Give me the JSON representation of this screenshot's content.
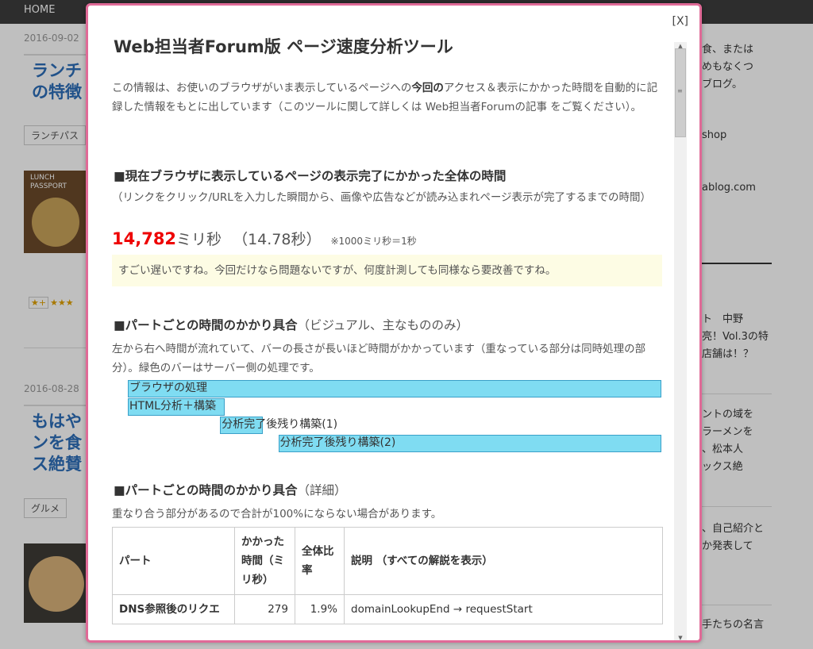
{
  "background": {
    "nav": {
      "home": "HOME"
    },
    "posts": [
      {
        "date": "2016-09-02",
        "title": "ランチ\nの特徴",
        "tag": "ランチパス"
      },
      {
        "date": "2016-08-28",
        "title": "もはや\nンを食\nス絶賛",
        "tag": "グルメ"
      }
    ],
    "thumb_text": "LUNCH\nPASSPORT",
    "stars": "★★★",
    "star_badge": "★+",
    "sidebar": [
      "食、または\nめもなくつ\nブログ。",
      "shop",
      "ablog.com",
      "ト　中野\n亮！Vol.3の特\n店舗は！？",
      "ントの域を\nラーメンを\n、松本人\nックス絶",
      "、自己紹介と\nか発表して",
      "手たちの名言"
    ]
  },
  "modal": {
    "close_label": "[X]",
    "title": "Web担当者Forum版 ページ速度分析ツール",
    "intro_a": "この情報は、お使いのブラウザがいま表示しているページへの",
    "intro_bold": "今回の",
    "intro_b": "アクセス＆表示にかかった時間を自動的に記録した情報をもとに出しています（このツールに関して詳しくは Web担当者Forumの記事 をご覧ください）。",
    "section1": {
      "heading": "■現在ブラウザに表示しているページの表示完了にかかった全体の時間",
      "desc": "（リンクをクリック/URLを入力した瞬間から、画像や広告などが読み込まれページ表示が完了するまでの時間）",
      "total_ms": "14,782",
      "unit_ms": "ミリ秒",
      "total_sec": "（14.78秒）",
      "note": "※1000ミリ秒＝1秒",
      "comment": "すごい遅いですね。今回だけなら問題ないですが、何度計測しても同様なら要改善ですね。"
    },
    "section2": {
      "heading": "■パートごとの時間のかかり具合",
      "heading_sub": "（ビジュアル、主なもののみ）",
      "desc": "左から右へ時間が流れていて、バーの長さが長いほど時間がかかっています（重なっている部分は同時処理の部分）。緑色のバーはサーバー側の処理です。",
      "bars": [
        {
          "label": "ブラウザの処理",
          "start": 0.0,
          "length": 1.0
        },
        {
          "label": "HTML分析＋構築",
          "start": 0.0,
          "length": 0.181
        },
        {
          "label": "分析完了後残り構築(1)",
          "start": 0.173,
          "length": 0.08
        },
        {
          "label": "分析完了後残り構築(2)",
          "start": 0.282,
          "length": 0.718
        }
      ]
    },
    "section3": {
      "heading": "■パートごとの時間のかかり具合",
      "heading_sub": "（詳細）",
      "desc": "重なり合う部分があるので合計が100%にならない場合があります。",
      "columns": [
        "パート",
        "かかった時間（ミリ秒）",
        "全体比率",
        "説明 （すべての解説を表示）"
      ],
      "rows": [
        {
          "part": "DNS参照後のリクエ",
          "ms": "279",
          "ratio": "1.9%",
          "desc": "domainLookupEnd → requestStart"
        }
      ]
    }
  }
}
